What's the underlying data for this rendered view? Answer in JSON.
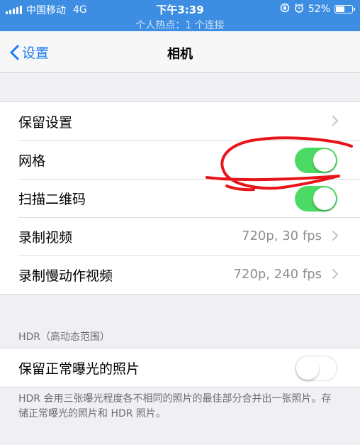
{
  "status_bar": {
    "carrier": "中国移动",
    "network": "4G",
    "time": "下午3:39",
    "battery": "52%",
    "battery_level": 0.52,
    "hotspot": "个人热点：1 个连接",
    "icons": [
      "signal-icon",
      "rotation-lock-icon",
      "alarm-icon",
      "battery-icon"
    ]
  },
  "nav": {
    "back_label": "设置",
    "title": "相机"
  },
  "group1": {
    "rows": [
      {
        "label": "保留设置",
        "type": "disclosure"
      },
      {
        "label": "网格",
        "type": "toggle",
        "on": true
      },
      {
        "label": "扫描二维码",
        "type": "toggle",
        "on": true
      },
      {
        "label": "录制视频",
        "value": "720p, 30 fps",
        "type": "disclosure"
      },
      {
        "label": "录制慢动作视频",
        "value": "720p, 240 fps",
        "type": "disclosure"
      }
    ]
  },
  "hdr": {
    "header": "HDR（高动态范围）",
    "rows": [
      {
        "label": "保留正常曝光的照片",
        "type": "toggle",
        "on": false
      }
    ],
    "footnote": "HDR 会用三张曝光程度各不相同的照片的最佳部分合并出一张照片。存储正常曝光的照片和 HDR 照片。"
  },
  "colors": {
    "status_bar": "#3d8ee3",
    "accent": "#1a7cf5",
    "toggle_on": "#4cd964",
    "background": "#efeff4",
    "annotation": "#e8141a"
  }
}
